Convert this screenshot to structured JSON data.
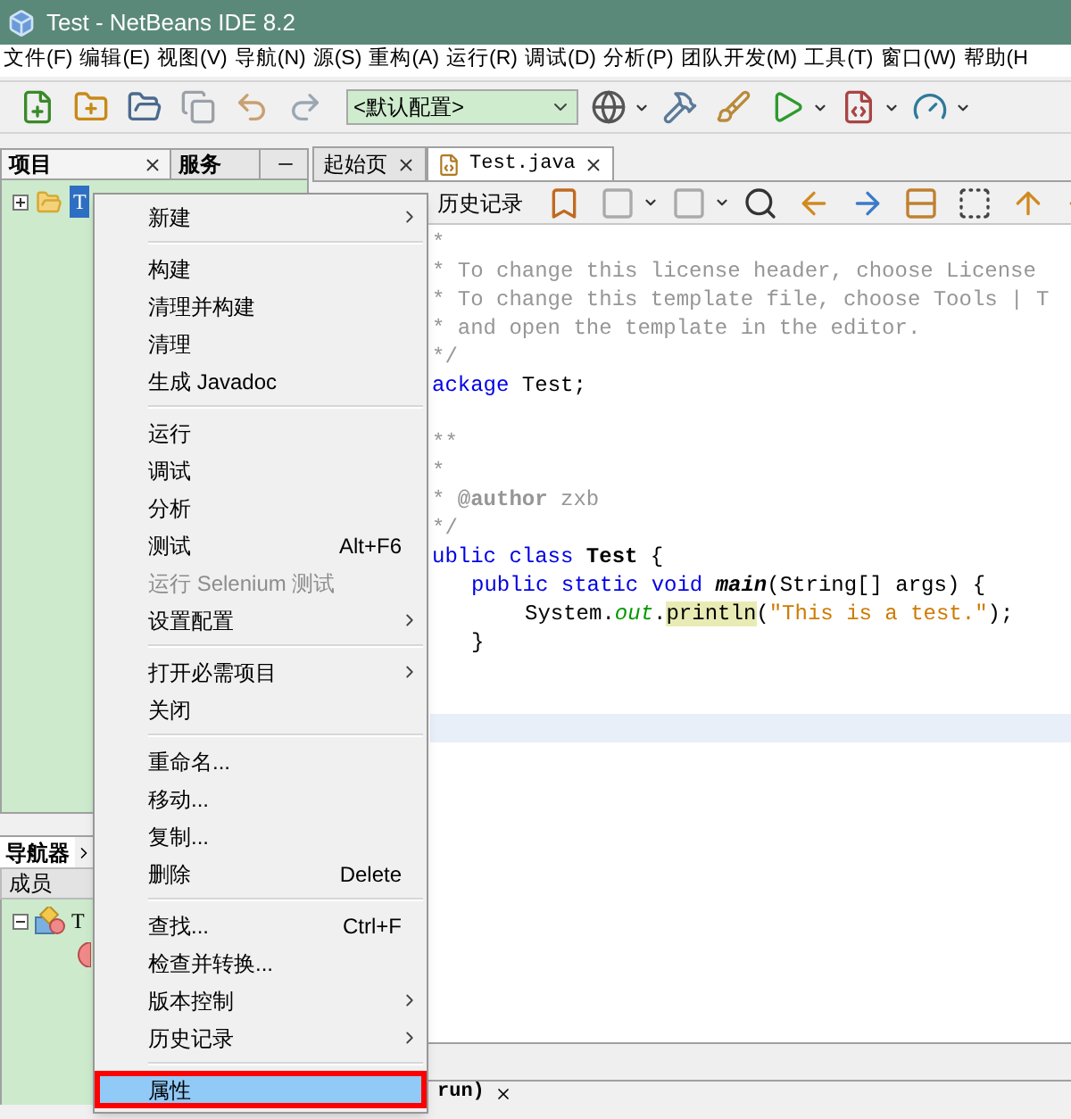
{
  "window": {
    "title": "Test - NetBeans IDE 8.2"
  },
  "menu_bar": [
    "文件(F)",
    "编辑(E)",
    "视图(V)",
    "导航(N)",
    "源(S)",
    "重构(A)",
    "运行(R)",
    "调试(D)",
    "分析(P)",
    "团队开发(M)",
    "工具(T)",
    "窗口(W)",
    "帮助(H"
  ],
  "toolbar": {
    "configuration": "<默认配置>"
  },
  "projects_panel": {
    "tabs": [
      {
        "label": "项目",
        "selected": true
      },
      {
        "label": "服务",
        "selected": false
      }
    ],
    "tree": [
      {
        "label": "T",
        "selected": true,
        "expanded": false
      }
    ]
  },
  "navigator": {
    "tab": "导航器",
    "header": "成员",
    "tree": [
      {
        "label": "T",
        "expanded": true
      }
    ]
  },
  "editor": {
    "tabs": [
      {
        "label": "起始页",
        "selected": false
      },
      {
        "label": "Test.java",
        "selected": true
      }
    ],
    "history_button": "历史记录",
    "lines": [
      {
        "kind": "code",
        "tokens": [
          {
            "kind": "comment",
            "text": "*"
          }
        ]
      },
      {
        "kind": "code",
        "tokens": [
          {
            "kind": "comment",
            "text": "* To change this license header, choose License"
          }
        ]
      },
      {
        "kind": "code",
        "tokens": [
          {
            "kind": "comment",
            "text": "* To change this template file, choose Tools | T"
          }
        ]
      },
      {
        "kind": "code",
        "tokens": [
          {
            "kind": "comment",
            "text": "* and open the template in the editor."
          }
        ]
      },
      {
        "kind": "code",
        "tokens": [
          {
            "kind": "comment",
            "text": "*/"
          }
        ]
      },
      {
        "kind": "code",
        "tokens": [
          {
            "kind": "keyword",
            "text": "ackage"
          },
          {
            "kind": "plain",
            "text": " Test;"
          }
        ]
      },
      {
        "kind": "blank"
      },
      {
        "kind": "code",
        "tokens": [
          {
            "kind": "comment",
            "text": "**"
          }
        ]
      },
      {
        "kind": "code",
        "tokens": [
          {
            "kind": "comment",
            "text": "*"
          }
        ]
      },
      {
        "kind": "code",
        "tokens": [
          {
            "kind": "comment",
            "text": "* "
          },
          {
            "kind": "tag",
            "text": "@author"
          },
          {
            "kind": "comment",
            "text": " zxb"
          }
        ]
      },
      {
        "kind": "code",
        "tokens": [
          {
            "kind": "comment",
            "text": "*/"
          }
        ]
      },
      {
        "kind": "code",
        "tokens": [
          {
            "kind": "keyword",
            "text": "ublic class"
          },
          {
            "kind": "bold",
            "text": " Test"
          },
          {
            "kind": "plain",
            "text": " {"
          }
        ]
      },
      {
        "kind": "indented",
        "tokens": [
          {
            "kind": "keyword",
            "text": "public static void"
          },
          {
            "kind": "method",
            "text": " main"
          },
          {
            "kind": "plain",
            "text": "(String[] args) {"
          }
        ]
      },
      {
        "kind": "double-indented",
        "tokens": [
          {
            "kind": "plain",
            "text": "System."
          },
          {
            "kind": "field",
            "text": "out"
          },
          {
            "kind": "plain",
            "text": "."
          },
          {
            "kind": "mark",
            "text": "println"
          },
          {
            "kind": "plain",
            "text": "("
          },
          {
            "kind": "string",
            "text": "\"This is a test.\""
          },
          {
            "kind": "plain",
            "text": ");"
          }
        ]
      },
      {
        "kind": "indented",
        "tokens": [
          {
            "kind": "plain",
            "text": "}"
          }
        ]
      },
      {
        "kind": "blank"
      },
      {
        "kind": "blank"
      },
      {
        "kind": "current"
      }
    ]
  },
  "output_tab": {
    "label": "run)"
  },
  "context_menu": [
    {
      "kind": "item",
      "label": "新建",
      "submenu": true,
      "disabled": false,
      "selected": false,
      "outlined": false
    },
    {
      "kind": "separator"
    },
    {
      "kind": "item",
      "label": "构建",
      "submenu": false,
      "disabled": false,
      "selected": false,
      "outlined": false
    },
    {
      "kind": "item",
      "label": "清理并构建",
      "submenu": false,
      "disabled": false,
      "selected": false,
      "outlined": false
    },
    {
      "kind": "item",
      "label": "清理",
      "submenu": false,
      "disabled": false,
      "selected": false,
      "outlined": false
    },
    {
      "kind": "item",
      "label": "生成 Javadoc",
      "submenu": false,
      "disabled": false,
      "selected": false,
      "outlined": false
    },
    {
      "kind": "separator"
    },
    {
      "kind": "item",
      "label": "运行",
      "submenu": false,
      "disabled": false,
      "selected": false,
      "outlined": false
    },
    {
      "kind": "item",
      "label": "调试",
      "submenu": false,
      "disabled": false,
      "selected": false,
      "outlined": false
    },
    {
      "kind": "item",
      "label": "分析",
      "submenu": false,
      "disabled": false,
      "selected": false,
      "outlined": false
    },
    {
      "kind": "item",
      "label": "测试",
      "shortcut": "Alt+F6",
      "submenu": false,
      "disabled": false,
      "selected": false,
      "outlined": false
    },
    {
      "kind": "item",
      "label": "运行 Selenium 测试",
      "submenu": false,
      "disabled": true,
      "selected": false,
      "outlined": false
    },
    {
      "kind": "item",
      "label": "设置配置",
      "submenu": true,
      "disabled": false,
      "selected": false,
      "outlined": false
    },
    {
      "kind": "separator"
    },
    {
      "kind": "item",
      "label": "打开必需项目",
      "submenu": true,
      "disabled": false,
      "selected": false,
      "outlined": false
    },
    {
      "kind": "item",
      "label": "关闭",
      "submenu": false,
      "disabled": false,
      "selected": false,
      "outlined": false
    },
    {
      "kind": "separator"
    },
    {
      "kind": "item",
      "label": "重命名...",
      "submenu": false,
      "disabled": false,
      "selected": false,
      "outlined": false
    },
    {
      "kind": "item",
      "label": "移动...",
      "submenu": false,
      "disabled": false,
      "selected": false,
      "outlined": false
    },
    {
      "kind": "item",
      "label": "复制...",
      "submenu": false,
      "disabled": false,
      "selected": false,
      "outlined": false
    },
    {
      "kind": "item",
      "label": "删除",
      "shortcut": "Delete",
      "submenu": false,
      "disabled": false,
      "selected": false,
      "outlined": false
    },
    {
      "kind": "separator"
    },
    {
      "kind": "item",
      "label": "查找...",
      "shortcut": "Ctrl+F",
      "submenu": false,
      "disabled": false,
      "selected": false,
      "outlined": false
    },
    {
      "kind": "item",
      "label": "检查并转换...",
      "submenu": false,
      "disabled": false,
      "selected": false,
      "outlined": false
    },
    {
      "kind": "item",
      "label": "版本控制",
      "submenu": true,
      "disabled": false,
      "selected": false,
      "outlined": false
    },
    {
      "kind": "item",
      "label": "历史记录",
      "submenu": true,
      "disabled": false,
      "selected": false,
      "outlined": false
    },
    {
      "kind": "separator"
    },
    {
      "kind": "item",
      "label": "属性",
      "submenu": false,
      "disabled": false,
      "selected": true,
      "outlined": true
    }
  ]
}
